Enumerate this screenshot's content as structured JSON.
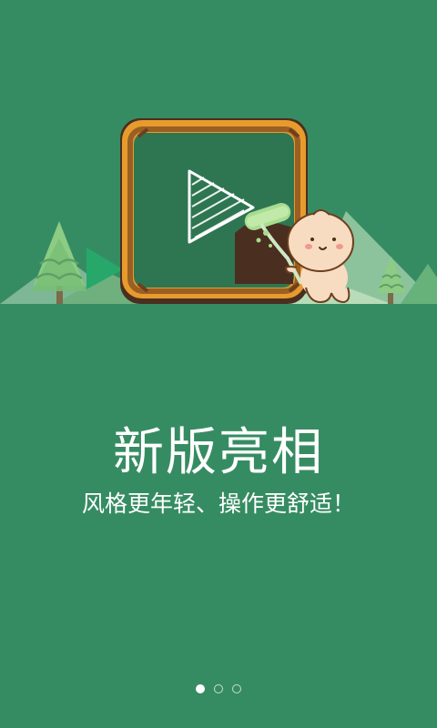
{
  "guide": {
    "headline": "新版亮相",
    "subline": "风格更年轻、操作更舒适！",
    "page_indicator": {
      "current": 1,
      "total": 3
    }
  },
  "colors": {
    "background": "#368c62",
    "text": "#ffffff"
  }
}
